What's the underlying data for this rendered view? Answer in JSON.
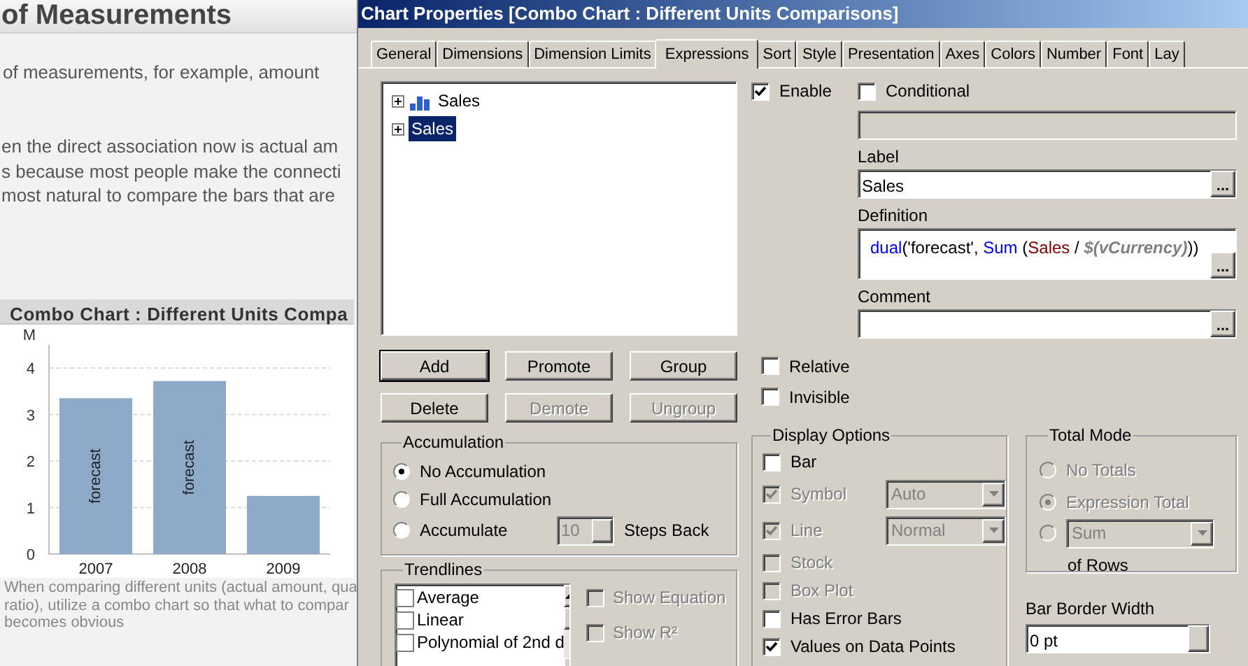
{
  "background": {
    "heading": "of Measurements",
    "paragraphs": [
      "of measurements, for example, amount",
      "en the direct association now is actual am\ns because most people make the connecti\nmost natural to compare the bars that are"
    ],
    "chart": {
      "title": "Combo Chart : Different Units Compa",
      "chart_data": {
        "type": "bar",
        "ylabel": "M",
        "categories": [
          "2007",
          "2008",
          "2009"
        ],
        "series": [
          {
            "color": "#8eaac9",
            "values": [
              3.35,
              3.72,
              1.25
            ]
          }
        ],
        "ylim": [
          0,
          4.5
        ],
        "grid": true,
        "yticks": [
          0,
          1,
          2,
          3,
          4
        ],
        "value_labels": [
          "forecast",
          "forecast",
          null
        ]
      },
      "caption": "When comparing different units (actual amount, qua\nratio), utilize a combo chart so that what to compar\nbecomes obvious"
    }
  },
  "dialog": {
    "title": "Chart Properties [Combo Chart : Different Units Comparisons]",
    "tabs": [
      {
        "label": "General",
        "selected": false
      },
      {
        "label": "Dimensions",
        "selected": false
      },
      {
        "label": "Dimension Limits",
        "selected": false
      },
      {
        "label": "Expressions",
        "selected": true
      },
      {
        "label": "Sort",
        "selected": false
      },
      {
        "label": "Style",
        "selected": false
      },
      {
        "label": "Presentation",
        "selected": false
      },
      {
        "label": "Axes",
        "selected": false
      },
      {
        "label": "Colors",
        "selected": false
      },
      {
        "label": "Number",
        "selected": false
      },
      {
        "label": "Font",
        "selected": false
      },
      {
        "label": "Lay",
        "selected": false
      }
    ],
    "expression_tree": [
      {
        "label": "Sales",
        "kind": "bar-chart",
        "expanded": false,
        "selected": false
      },
      {
        "label": "Sales",
        "kind": "plain",
        "expanded": false,
        "selected": true
      }
    ],
    "buttons": [
      {
        "label": "Add",
        "disabled": false,
        "focused": true
      },
      {
        "label": "Promote",
        "disabled": false,
        "focused": false
      },
      {
        "label": "Group",
        "disabled": false,
        "focused": false
      },
      {
        "label": "Delete",
        "disabled": false,
        "focused": false
      },
      {
        "label": "Demote",
        "disabled": true,
        "focused": false
      },
      {
        "label": "Ungroup",
        "disabled": true,
        "focused": false
      }
    ],
    "accumulation": {
      "title": "Accumulation",
      "options": [
        {
          "label": "No Accumulation",
          "selected": true
        },
        {
          "label": "Full Accumulation",
          "selected": false
        },
        {
          "label": "Accumulate",
          "selected": false
        }
      ],
      "steps_value": "10",
      "steps_disabled": true,
      "steps_label": "Steps Back"
    },
    "trendlines": {
      "title": "Trendlines",
      "items": [
        {
          "label": "Average",
          "checked": false
        },
        {
          "label": "Linear",
          "checked": false
        },
        {
          "label": "Polynomial of 2nd d",
          "checked": false
        }
      ],
      "options": [
        {
          "label": "Show Equation",
          "checked": false,
          "disabled": true
        },
        {
          "label": "Show R²",
          "checked": false,
          "disabled": true
        }
      ]
    },
    "enable": {
      "label": "Enable",
      "checked": true
    },
    "conditional": {
      "label": "Conditional",
      "checked": false
    },
    "label_field": {
      "label": "Label",
      "value": "Sales",
      "button": "..."
    },
    "definition": {
      "label": "Definition",
      "button": "...",
      "tokens": [
        {
          "kind": "function",
          "text": "dual"
        },
        {
          "kind": "plain",
          "text": "('forecast', "
        },
        {
          "kind": "function",
          "text": "Sum"
        },
        {
          "kind": "plain",
          "text": " ("
        },
        {
          "kind": "field",
          "text": "Sales"
        },
        {
          "kind": "plain",
          "text": " / "
        },
        {
          "kind": "variable",
          "text": "$(vCurrency)"
        },
        {
          "kind": "plain",
          "text": "))"
        }
      ]
    },
    "comment": {
      "label": "Comment",
      "button": "..."
    },
    "flags": [
      {
        "label": "Relative",
        "checked": false
      },
      {
        "label": "Invisible",
        "checked": false
      }
    ],
    "display_options": {
      "title": "Display Options",
      "items": [
        {
          "label": "Bar",
          "kind": "checkbox",
          "checked": false,
          "disabled": false
        },
        {
          "label": "Symbol",
          "kind": "dropdown",
          "checked": true,
          "disabled": true,
          "value": "Auto"
        },
        {
          "label": "Line",
          "kind": "dropdown",
          "checked": true,
          "disabled": true,
          "value": "Normal"
        },
        {
          "label": "Stock",
          "kind": "checkbox",
          "checked": false,
          "disabled": true
        },
        {
          "label": "Box Plot",
          "kind": "checkbox",
          "checked": false,
          "disabled": true
        },
        {
          "label": "Has Error Bars",
          "kind": "checkbox",
          "checked": false,
          "disabled": false
        },
        {
          "label": "Values on Data Points",
          "kind": "checkbox",
          "checked": true,
          "disabled": false
        }
      ]
    },
    "total_mode": {
      "title": "Total Mode",
      "options": [
        {
          "label": "No Totals",
          "kind": "radio",
          "selected": false,
          "disabled": true
        },
        {
          "label": "Expression Total",
          "kind": "radio",
          "selected": true,
          "disabled": true
        },
        {
          "kind": "dropdown",
          "value": "Sum",
          "selected": false,
          "disabled": true
        }
      ],
      "suffix": "of Rows"
    },
    "bar_border_width": {
      "label": "Bar Border Width",
      "value": "0 pt"
    }
  }
}
